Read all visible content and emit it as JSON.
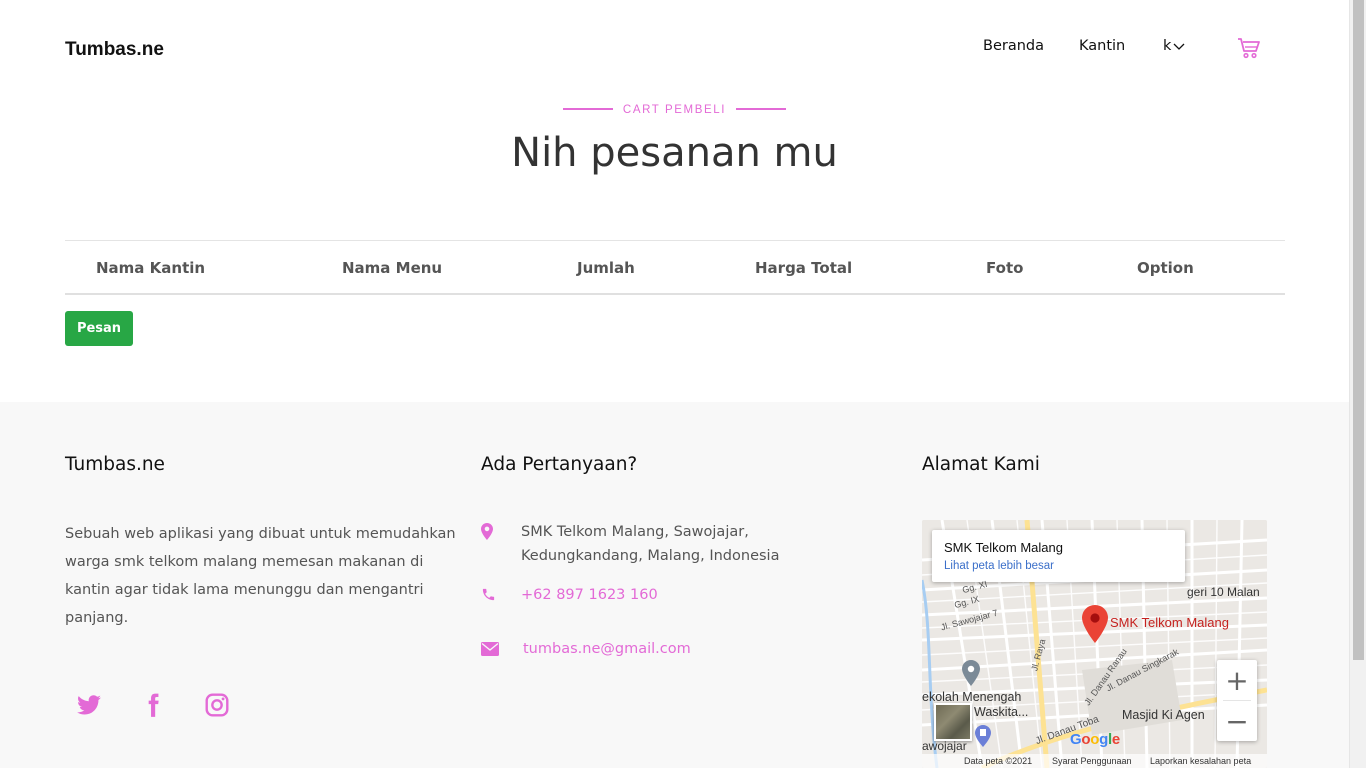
{
  "navbar": {
    "brand": "Tumbas.ne",
    "items": [
      {
        "label": "Beranda"
      },
      {
        "label": "Kantin"
      },
      {
        "label": "k"
      }
    ],
    "accent_color": "#e36ad6"
  },
  "header": {
    "subheading": "CART PEMBELI",
    "title": "Nih pesanan mu"
  },
  "cart_table": {
    "columns": [
      "Nama Kantin",
      "Nama Menu",
      "Jumlah",
      "Harga Total",
      "Foto",
      "Option"
    ],
    "rows": []
  },
  "order_button": {
    "label": "Pesan",
    "color": "#28a745"
  },
  "footer": {
    "about": {
      "heading": "Tumbas.ne",
      "text": "Sebuah web aplikasi yang dibuat untuk memudahkan warga smk telkom malang memesan makanan di kantin agar tidak lama menunggu dan mengantri panjang."
    },
    "social": [
      {
        "icon": "twitter-icon"
      },
      {
        "icon": "facebook-icon"
      },
      {
        "icon": "instagram-icon"
      }
    ],
    "contact": {
      "heading": "Ada Pertanyaan?",
      "address_line1": "SMK Telkom Malang, Sawojajar,",
      "address_line2": "Kedungkandang, Malang, Indonesia",
      "phone": "+62 897 1623 160",
      "email": "tumbas.ne@gmail.com"
    },
    "location": {
      "heading": "Alamat Kami",
      "map": {
        "place_name": "SMK Telkom Malang",
        "larger_map_link": "Lihat peta lebih besar",
        "marker_label": "SMK Telkom Malang",
        "labels": {
          "school": "ekolah Menengah",
          "school2": "Waskita...",
          "mosque": "Masjid Ki Agen",
          "road1": "Jl. Danau Toba",
          "road2": "Jl. Danau Singkarak",
          "road3": "Jl. Danau Ranau",
          "road4": "Jl. Sawojajar 7",
          "road5": "Jl. Raya",
          "area1": "geri 10 Malan",
          "area2": "awojajar",
          "road6": "Gg. IX",
          "road7": "Gg. XI"
        },
        "zoom_in": "+",
        "zoom_out": "−",
        "google": "Google",
        "footer_data": "Data peta ©2021",
        "footer_terms": "Syarat Penggunaan",
        "footer_report": "Laporkan kesalahan peta"
      }
    }
  }
}
